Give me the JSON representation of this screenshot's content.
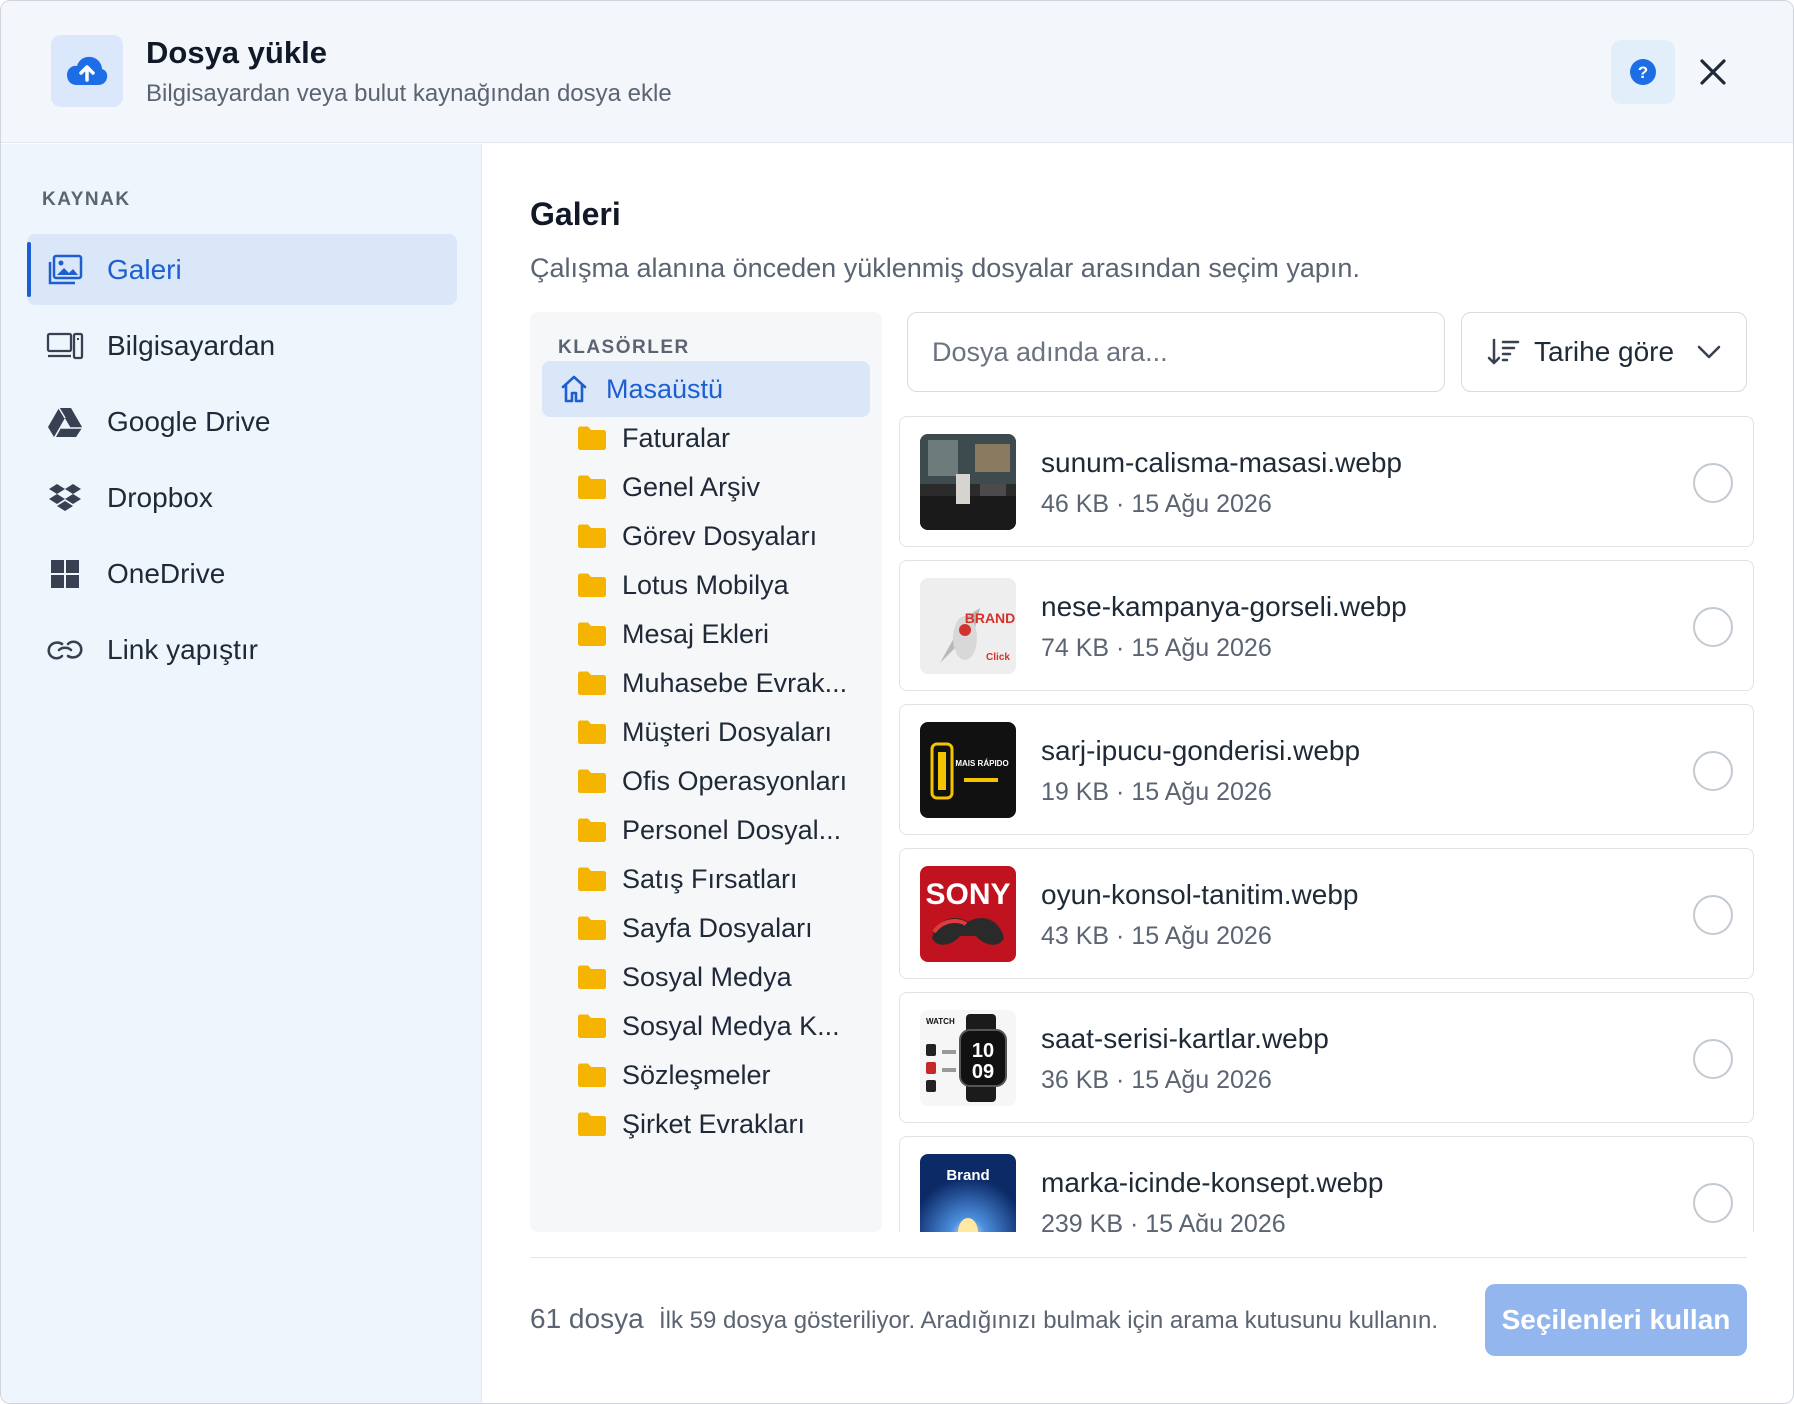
{
  "header": {
    "title": "Dosya yükle",
    "subtitle": "Bilgisayardan veya bulut kaynağından dosya ekle",
    "help_icon": "question-icon",
    "close_icon": "close-icon"
  },
  "sidebar": {
    "heading": "KAYNAK",
    "items": [
      {
        "label": "Galeri",
        "icon": "gallery-icon",
        "active": true
      },
      {
        "label": "Bilgisayardan",
        "icon": "computer-icon",
        "active": false
      },
      {
        "label": "Google Drive",
        "icon": "google-drive-icon",
        "active": false
      },
      {
        "label": "Dropbox",
        "icon": "dropbox-icon",
        "active": false
      },
      {
        "label": "OneDrive",
        "icon": "onedrive-icon",
        "active": false
      },
      {
        "label": "Link yapıştır",
        "icon": "link-icon",
        "active": false
      }
    ]
  },
  "main": {
    "title": "Galeri",
    "description": "Çalışma alanına önceden yüklenmiş dosyalar arasından seçim yapın."
  },
  "folders": {
    "heading": "KLASÖRLER",
    "items": [
      {
        "label": "Masaüstü",
        "icon": "home-icon",
        "active": true
      },
      {
        "label": "Faturalar",
        "icon": "folder-icon"
      },
      {
        "label": "Genel Arşiv",
        "icon": "folder-icon"
      },
      {
        "label": "Görev Dosyaları",
        "icon": "folder-icon"
      },
      {
        "label": "Lotus Mobilya",
        "icon": "folder-icon"
      },
      {
        "label": "Mesaj Ekleri",
        "icon": "folder-icon"
      },
      {
        "label": "Muhasebe Evrak...",
        "icon": "folder-icon"
      },
      {
        "label": "Müşteri Dosyaları",
        "icon": "folder-icon"
      },
      {
        "label": "Ofis Operasyonları",
        "icon": "folder-icon"
      },
      {
        "label": "Personel Dosyal...",
        "icon": "folder-icon"
      },
      {
        "label": "Satış Fırsatları",
        "icon": "folder-icon"
      },
      {
        "label": "Sayfa Dosyaları",
        "icon": "folder-icon"
      },
      {
        "label": "Sosyal Medya",
        "icon": "folder-icon"
      },
      {
        "label": "Sosyal Medya K...",
        "icon": "folder-icon"
      },
      {
        "label": "Sözleşmeler",
        "icon": "folder-icon"
      },
      {
        "label": "Şirket Evrakları",
        "icon": "folder-icon"
      }
    ]
  },
  "search": {
    "placeholder": "Dosya adında ara...",
    "value": ""
  },
  "sort": {
    "label": "Tarihe göre",
    "icon": "sort-descending-icon",
    "chevron": "chevron-down-icon"
  },
  "files": [
    {
      "name": "sunum-calisma-masasi.webp",
      "meta": "46 KB · 15 Ağu 2026",
      "thumb": "office-desk-photo",
      "selected": false
    },
    {
      "name": "nese-kampanya-gorseli.webp",
      "meta": "74 KB · 15 Ağu 2026",
      "thumb": "rocket-campaign-image",
      "thumb_text": "BRAND",
      "selected": false
    },
    {
      "name": "sarj-ipucu-gonderisi.webp",
      "meta": "19 KB · 15 Ağu 2026",
      "thumb": "charger-post-image",
      "thumb_text": "MAIS RÁPIDO",
      "selected": false
    },
    {
      "name": "oyun-konsol-tanitim.webp",
      "meta": "43 KB · 15 Ağu 2026",
      "thumb": "console-promo-image",
      "thumb_text": "SONY",
      "selected": false
    },
    {
      "name": "saat-serisi-kartlar.webp",
      "meta": "36 KB · 15 Ağu 2026",
      "thumb": "watch-series-image",
      "thumb_text": "WATCH",
      "thumb_text2": "10",
      "thumb_text3": "09",
      "selected": false
    },
    {
      "name": "marka-icinde-konsept.webp",
      "meta": "239 KB · 15 Ağu 2026",
      "thumb": "brand-concept-image",
      "thumb_text": "Brand",
      "selected": false
    }
  ],
  "footer": {
    "count": "61 dosya",
    "note": "İlk 59 dosya gösteriliyor. Aradığınızı bulmak için arama kutusunu kullanın.",
    "use_button": "Seçilenleri kullan"
  },
  "colors": {
    "accent": "#1d5fd1",
    "folder": "#f5b400",
    "button_disabled": "#93b6ef"
  }
}
